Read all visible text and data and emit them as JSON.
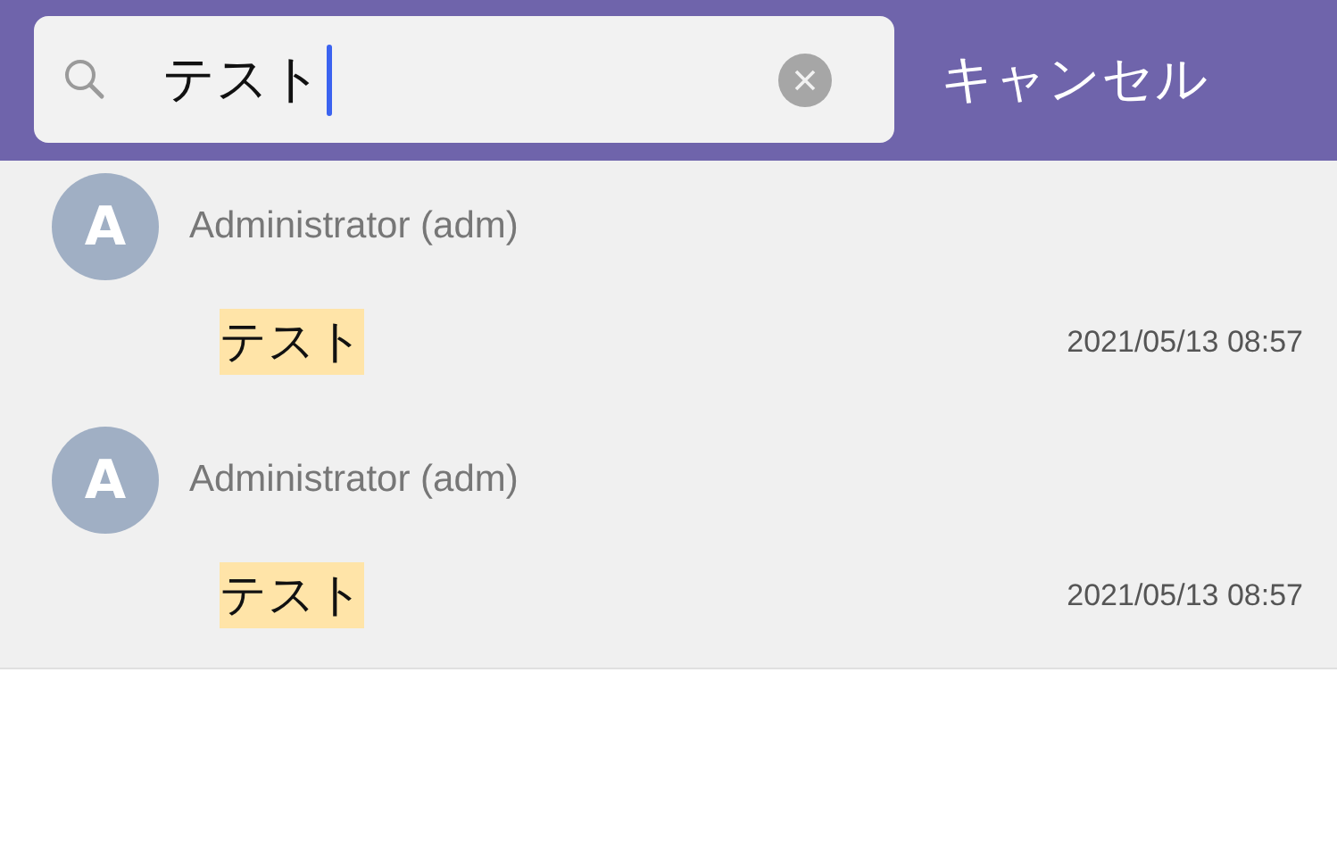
{
  "search": {
    "value": "テスト",
    "cancel": "キャンセル"
  },
  "results": [
    {
      "avatar": "A",
      "name": "Administrator (adm)",
      "message": "テスト",
      "highlighted": true,
      "time": "2021/05/13 08:57"
    },
    {
      "avatar": "A",
      "name": "Administrator (adm)",
      "message": "テスト",
      "highlighted": true,
      "time": "2021/05/13 08:57"
    }
  ]
}
